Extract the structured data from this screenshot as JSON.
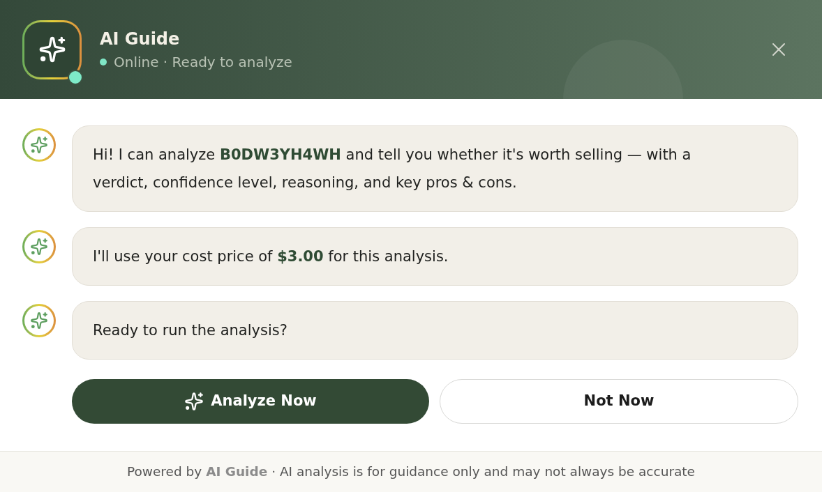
{
  "header": {
    "title": "AI Guide",
    "online": true,
    "status": "Online · Ready to analyze"
  },
  "messages": [
    {
      "text": "Hi! I can analyze **B0DW3YH4WH** and tell you whether it's worth selling — with a verdict, confidence level, reasoning, and key pros & cons."
    },
    {
      "text": "I'll use your cost price of **$3.00** for this analysis."
    },
    {
      "text": "Ready to run the analysis?"
    }
  ],
  "actions": [
    {
      "label": "Analyze Now",
      "kind": "primary"
    },
    {
      "label": "Not Now",
      "kind": "secondary"
    }
  ],
  "footer": {
    "text": "Powered by **AI Guide** · AI analysis is for guidance only and may not always be accurate"
  }
}
